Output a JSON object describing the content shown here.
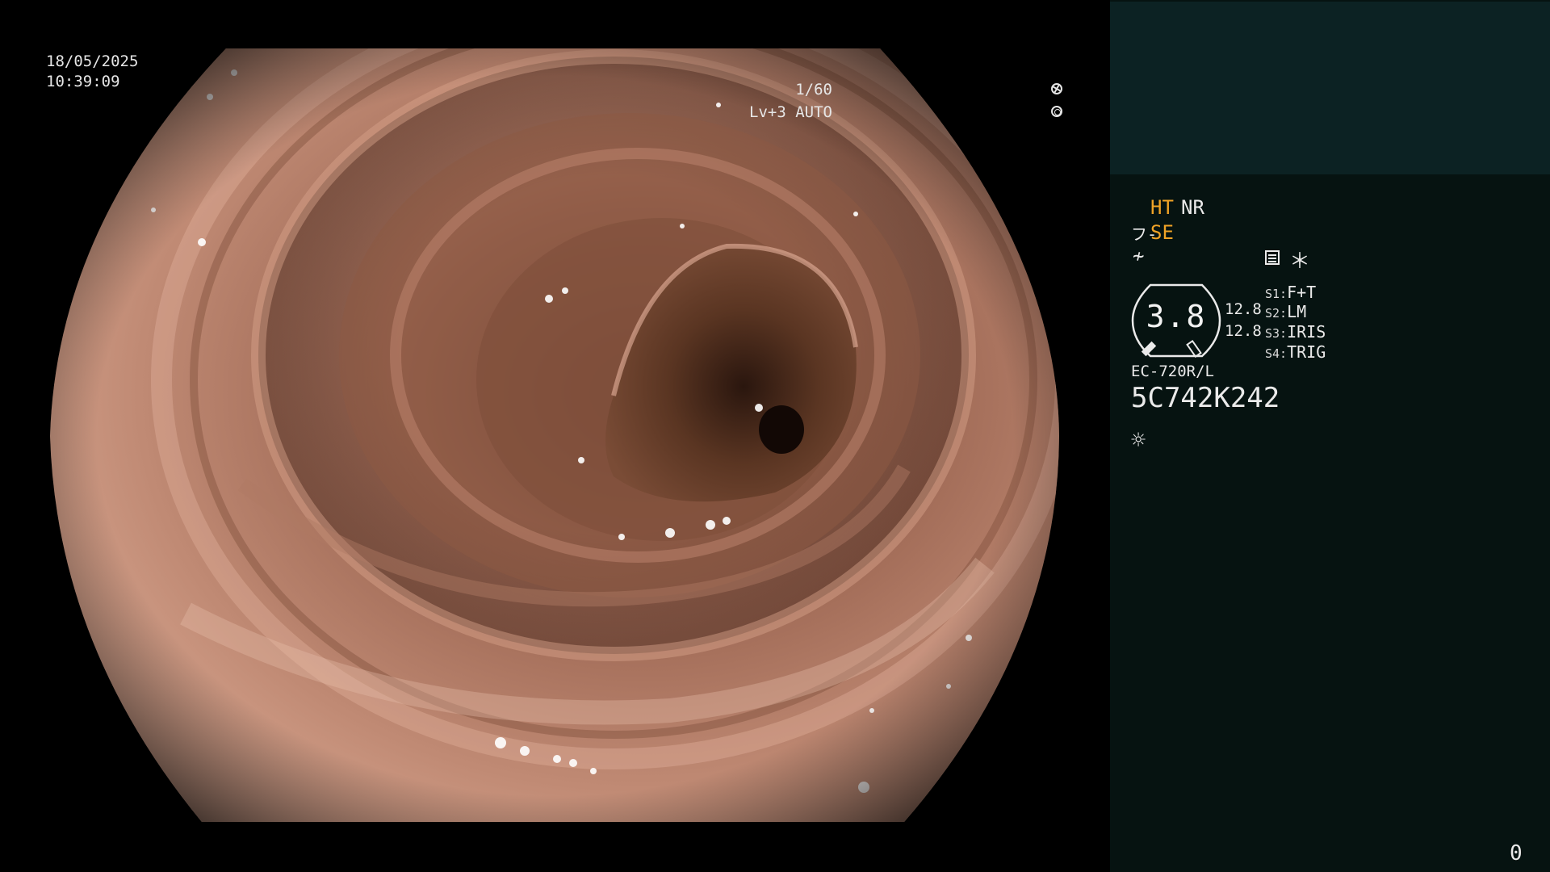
{
  "osd": {
    "date": "18/05/2025",
    "time": "10:39:09",
    "shutter": "1/60",
    "level": "Lv+3 AUTO",
    "shutter_icon": "shutter-icon",
    "iris_icon": "iris-icon"
  },
  "panel": {
    "ht": "HT",
    "nr": "NR",
    "se_icon": "フ-",
    "se": "SE",
    "sharp_icon": "≁",
    "memo_icon": "memo-icon",
    "star": "＊",
    "zoom_value": "3.8",
    "zoom_a": "12.8",
    "zoom_b": "12.8",
    "switches": [
      {
        "key": "S1:",
        "value": "F+T"
      },
      {
        "key": "S2:",
        "value": "LM"
      },
      {
        "key": "S3:",
        "value": "IRIS"
      },
      {
        "key": "S4:",
        "value": "TRIG"
      }
    ],
    "scope_model": "EC-720R/L",
    "scope_serial": "5C742K242",
    "light_icon": "☼"
  },
  "counter": "0",
  "colors": {
    "panel_bg": "#061311",
    "patient_box_bg": "#0c2223",
    "accent_orange": "#f0a326",
    "text": "#eaeaea"
  }
}
